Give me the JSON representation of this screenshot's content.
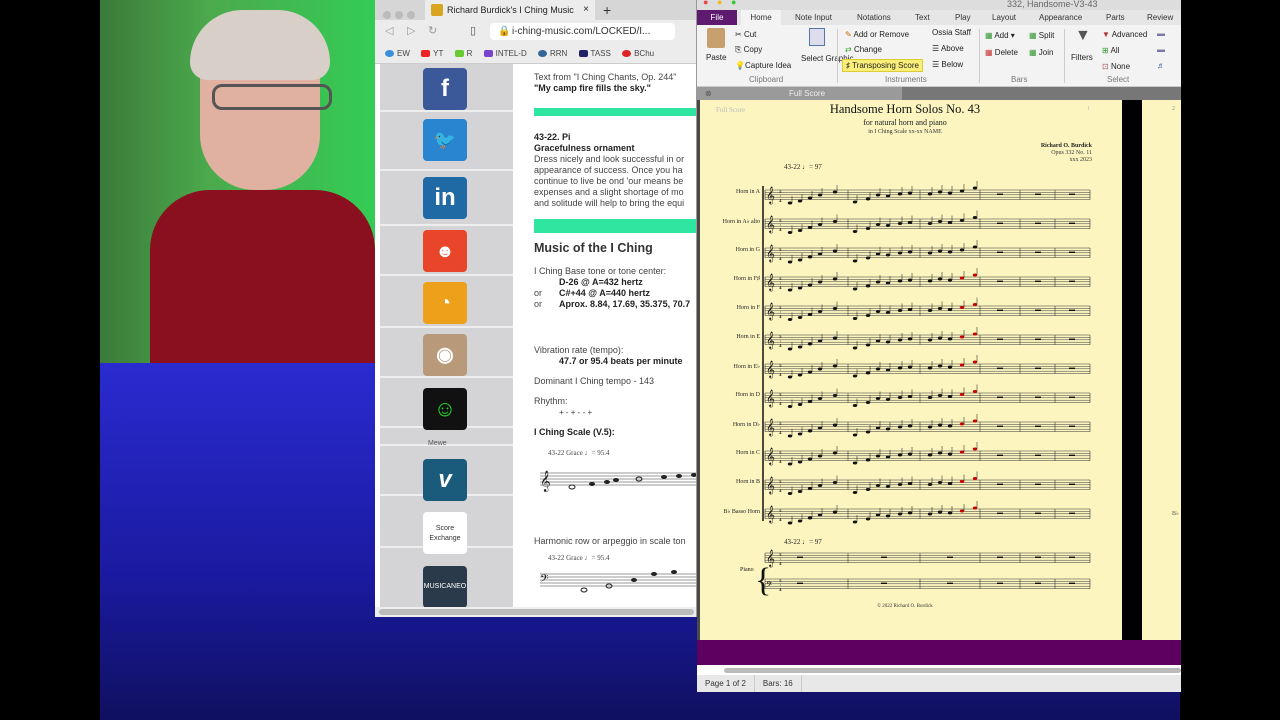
{
  "browser": {
    "tab_title": "Richard Burdick's I Ching Music",
    "url": "i-ching-music.com/LOCKED/I...",
    "bookmarks": [
      "EW",
      "YT",
      "R",
      "INTEL-D",
      "RRN",
      "TASS",
      "BChu"
    ],
    "sidebar_icons": [
      "facebook-icon",
      "twitter-icon",
      "linkedin-icon",
      "reddit-icon",
      "rss-icon",
      "instagram-icon",
      "gab-icon",
      "mewe-icon",
      "vimeo-icon",
      "score-exchange-icon",
      "musicaneo-icon"
    ],
    "mewe_label": "Mewe",
    "score_exchange_label": "Score Exchange",
    "musicaneo_label": "MUSICANEO",
    "page": {
      "source_line": "Text from \"I Ching Chants, Op. 244\"",
      "quote": "\"My camp fire fills the sky.\"",
      "hex_number": "43-22. Pi",
      "hex_name": "Gracefulness ornament",
      "body": [
        "Dress nicely and look successful in or",
        "appearance of success. Once you ha",
        "continue to live be ond 'our means be",
        "expenses and a slight shortage of mo",
        "and solitude will help to bring the equi"
      ],
      "heading": "Music of the I Ching",
      "base_tone_label": "I Ching Base tone or tone center:",
      "tone1": "D-26 @ A=432 hertz",
      "or": "or",
      "tone2": "C#+44 @ A=440 hertz",
      "tone3": "Aprox. 8.84, 17.69, 35.375, 70.7",
      "vibration_label": "Vibration rate (tempo):",
      "vibration_value": "47.7 or 95.4 beats per minute",
      "dominant_tempo": "Dominant I Ching tempo - 143",
      "rhythm_label": "Rhythm:",
      "rhythm_value": "+ - + - - +",
      "scale_heading": "I Ching Scale (V.5):",
      "scale_caption": "43-22 Grace ♩= 95.4",
      "harmonic_label": "Harmonic row or arpeggio in scale ton",
      "harmonic_caption": "43-22 Grace ♩= 95.4"
    }
  },
  "sibelius": {
    "window_title": "332, Handsome-V3-43",
    "tabs": [
      "File",
      "Home",
      "Note Input",
      "Notations",
      "Text",
      "Play",
      "Layout",
      "Appearance",
      "Parts",
      "Review"
    ],
    "active_tab": "Home",
    "ribbon": {
      "paste": "Paste",
      "cut": "Cut",
      "copy": "Copy",
      "capture_idea": "Capture Idea",
      "select_graphic": "Select Graphic",
      "clipboard_group": "Clipboard",
      "add_or_remove": "Add or Remove",
      "change": "Change",
      "transposing_score": "Transposing Score",
      "ossia_staff": "Ossia Staff",
      "above": "Above",
      "below": "Below",
      "instruments_group": "Instruments",
      "add": "Add",
      "delete": "Delete",
      "split": "Split",
      "join": "Join",
      "bars_group": "Bars",
      "filters": "Filters",
      "advanced": "Advanced",
      "all": "All",
      "none": "None",
      "select_group": "Select"
    },
    "doc_tab": "Full Score",
    "score": {
      "header_label": "Full Score",
      "page_number": "1",
      "page2_number": "2",
      "title": "Handsome Horn Solos No. 43",
      "subtitle": "for natural horn and piano",
      "subsubtitle": "in I Ching Scale xx-xx NAME",
      "composer": "Richard O. Burdick",
      "opus": "Opus 332 No. 11",
      "year": "xxx 2023",
      "tempo_mark": "43-22  ♩= 97",
      "instruments": [
        "Horn in A",
        "Horn in A♭ alto",
        "Horn in G",
        "Horn in F♯",
        "Horn in F",
        "Horn in E",
        "Horn in E♭",
        "Horn in D",
        "Horn in D♭",
        "Horn in C",
        "Horn in B",
        "B♭ Basso Horn"
      ],
      "piano_label": "Piano",
      "piano_tempo": "43-22  ♩= 97",
      "time_signature": "5/4",
      "copyright": "© 2022 Richard O. Burdick",
      "page2_label": "B♭"
    },
    "status": {
      "page": "Page 1 of 2",
      "bars": "Bars: 16"
    }
  }
}
